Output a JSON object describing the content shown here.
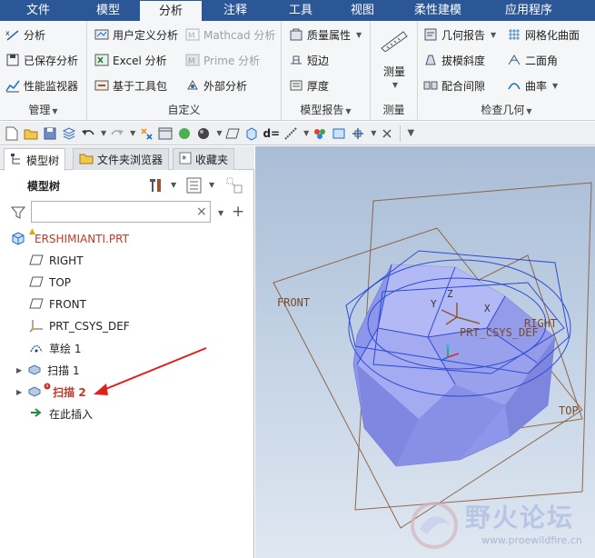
{
  "ribbon_tabs": [
    {
      "label": "文件",
      "active": false
    },
    {
      "label": "模型",
      "active": false
    },
    {
      "label": "分析",
      "active": true
    },
    {
      "label": "注释",
      "active": false
    },
    {
      "label": "工具",
      "active": false
    },
    {
      "label": "视图",
      "active": false
    },
    {
      "label": "柔性建模",
      "active": false
    },
    {
      "label": "应用程序",
      "active": false
    }
  ],
  "groups": {
    "manage": {
      "label": "管理",
      "items": [
        "分析",
        "已保存分析",
        "性能监视器"
      ]
    },
    "custom": {
      "label": "自定义",
      "items": [
        "用户定义分析",
        "Excel 分析",
        "基于工具包",
        "Mathcad 分析",
        "Prime 分析",
        "外部分析"
      ]
    },
    "model_report": {
      "label": "模型报告",
      "items": [
        "质量属性",
        "短边",
        "厚度"
      ]
    },
    "measure": {
      "label": "测量",
      "button": "测量"
    },
    "inspect_geometry": {
      "label": "检查几何",
      "items": [
        "几何报告",
        "拔模斜度",
        "配合间隙",
        "网格化曲面",
        "二面角",
        "曲率"
      ]
    }
  },
  "toolbar": {
    "d_label": "d="
  },
  "panel_tabs": [
    "模型树",
    "文件夹浏览器",
    "收藏夹"
  ],
  "tree_header": "模型树",
  "filter": {
    "value": "",
    "clear": "×"
  },
  "tree": {
    "root": "ERSHIMIANTI.PRT",
    "items": [
      "RIGHT",
      "TOP",
      "FRONT",
      "PRT_CSYS_DEF",
      "草绘 1",
      "扫描 1",
      "扫描 2",
      "在此插入"
    ]
  },
  "viewport_labels": {
    "front": "FRONT",
    "right": "RIGHT",
    "top": "TOP",
    "csys": "PRT_CSYS_DEF",
    "x": "X",
    "y": "Y",
    "z": "Z"
  },
  "watermark": {
    "cn": "野火论坛",
    "en": "www.proewildfire.cn"
  },
  "colors": {
    "tab_bar": "#2b5797",
    "error_red": "#c0392b",
    "arrow_red": "#e0201c",
    "plane_brown": "#8a5a3a",
    "edge_blue": "#2d4ad6",
    "solid_fill": "#8d96ea"
  }
}
